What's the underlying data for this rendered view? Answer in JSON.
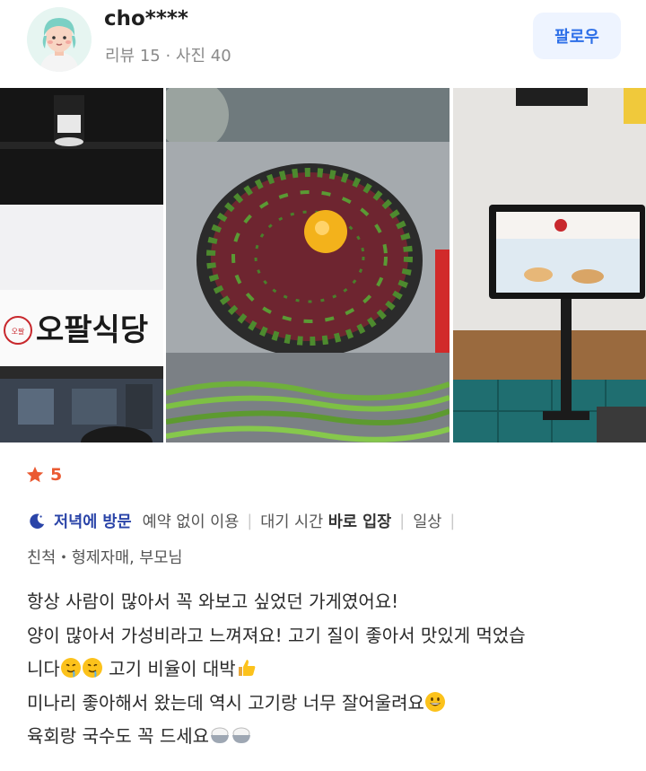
{
  "user": {
    "name": "cho****",
    "stats": "리뷰 15 · 사진 40",
    "follow_label": "팔로우"
  },
  "photos": {
    "p1_sign_text": "오팔식당",
    "p1_logo_small": "오팔"
  },
  "rating": {
    "value": "5"
  },
  "meta": {
    "visit_time": "저녁에 방문",
    "tags": [
      {
        "label": "예약 없이 이용"
      },
      {
        "label": "대기 시간",
        "value": "바로 입장"
      },
      {
        "label": "일상"
      }
    ],
    "companions": "친척・형제자매, 부모님"
  },
  "review": {
    "lines": [
      "항상 사람이 많아서 꼭 와보고 싶었던 가게였어요!",
      "양이 많아서 가성비라고 느껴져요! 고기 질이 좋아서 맛있게 먹었습",
      "니다",
      " 고기 비율이 대박",
      "미나리 좋아해서 왔는데 역시 고기랑 너무 잘어울려요",
      "육회랑 국수도 꼭 드세요"
    ]
  },
  "colors": {
    "accent_blue": "#2d6fe8",
    "star": "#ea5a32",
    "visit": "#2a44a8"
  }
}
